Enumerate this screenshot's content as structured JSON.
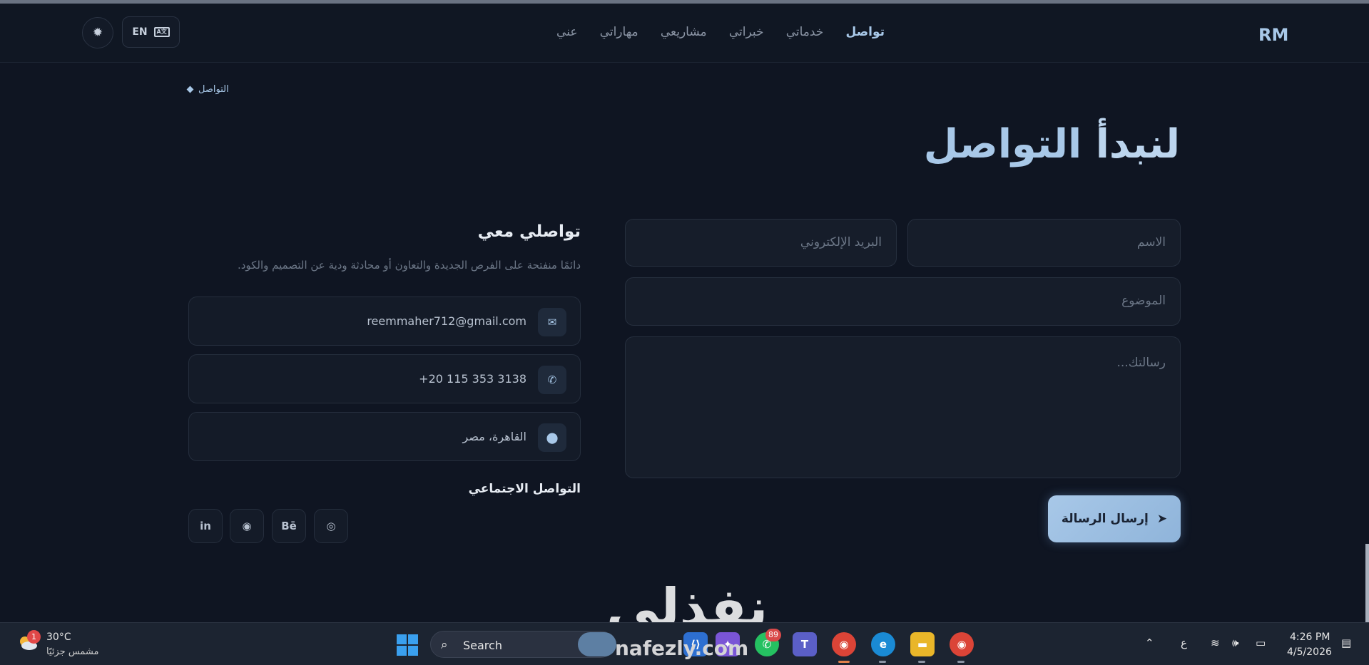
{
  "header": {
    "logo": "RM",
    "lang_label": "EN",
    "theme_icon": "sun-icon",
    "nav": [
      {
        "label": "تواصل",
        "active": true
      },
      {
        "label": "خدماتي"
      },
      {
        "label": "خبراتي"
      },
      {
        "label": "مشاريعي"
      },
      {
        "label": "مهاراتي"
      },
      {
        "label": "عني"
      }
    ]
  },
  "breadcrumb": "التواصل",
  "page_title": {
    "first": "لنبدأ",
    "second": "التواصل"
  },
  "contact": {
    "title": "تواصلي معي",
    "description": "دائمًا منفتحة على الفرص الجديدة والتعاون أو محادثة ودية عن التصميم والكود.",
    "items": [
      {
        "icon": "envelope-icon",
        "text": "reemmaher712@gmail.com"
      },
      {
        "icon": "phone-icon",
        "text": "+20 115 353 3138"
      },
      {
        "icon": "location-pin-icon",
        "text": "القاهرة، مصر"
      }
    ],
    "social_title": "التواصل الاجتماعي",
    "social": [
      {
        "icon": "instagram-icon",
        "glyph": "◎"
      },
      {
        "icon": "behance-icon",
        "glyph": "Bē"
      },
      {
        "icon": "github-icon",
        "glyph": "◉"
      },
      {
        "icon": "linkedin-icon",
        "glyph": "in"
      }
    ]
  },
  "form": {
    "name_placeholder": "الاسم",
    "email_placeholder": "البريد الإلكتروني",
    "subject_placeholder": "الموضوع",
    "message_placeholder": "رسالتك...",
    "submit_label": "إرسال الرسالة"
  },
  "watermark": {
    "arabic": "نفذلي",
    "latin": "nafezly.com"
  },
  "taskbar": {
    "weather_badge": "1",
    "weather_temp": "30°C",
    "weather_desc": "مشمس جزئيًا",
    "search_label": "Search",
    "whatsapp_badge": "89",
    "keyboard_lang": "ع",
    "time": "4:26 PM",
    "date": "4/5/2026"
  }
}
